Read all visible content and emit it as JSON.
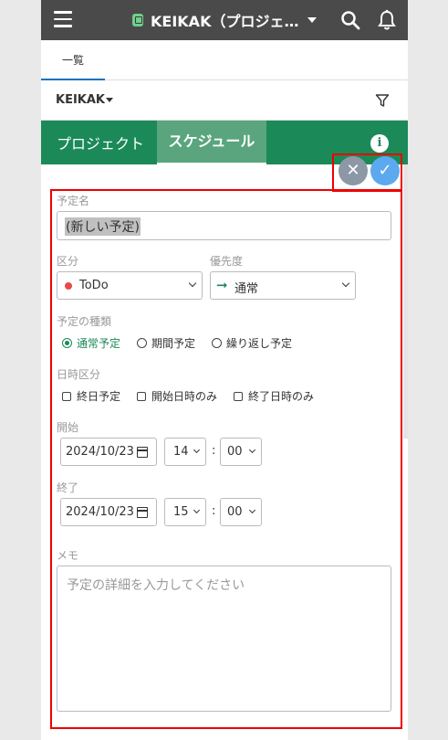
{
  "topbar": {
    "title": "KEIKAK（プロジェ…",
    "menu_icon": "hamburger-icon",
    "search_icon": "search-icon",
    "notification_icon": "bell-icon"
  },
  "list_tab": {
    "label": "一覧"
  },
  "filter": {
    "project": "KEIKAK",
    "filter_icon": "filter-icon"
  },
  "green_tabs": {
    "project": "プロジェクト",
    "schedule": "スケジュール",
    "info_icon": "info-icon"
  },
  "actions": {
    "cancel_glyph": "✕",
    "confirm_glyph": "✓"
  },
  "form": {
    "name_label": "予定名",
    "name_value": "(新しい予定)",
    "category_label": "区分",
    "category_value": "ToDo",
    "priority_label": "優先度",
    "priority_arrow": "➞",
    "priority_value": "通常",
    "type_label": "予定の種類",
    "type_options": [
      "通常予定",
      "期間予定",
      "繰り返し予定"
    ],
    "datetime_label": "日時区分",
    "datetime_options": [
      "終日予定",
      "開始日時のみ",
      "終了日時のみ"
    ],
    "start_label": "開始",
    "start_date": "2024/10/23",
    "start_hour": "14",
    "start_minute": "00",
    "end_label": "終了",
    "end_date": "2024/10/23",
    "end_hour": "15",
    "end_minute": "00",
    "time_separator": ":",
    "memo_label": "メモ",
    "memo_placeholder": "予定の詳細を入力してください"
  },
  "colors": {
    "brand_green": "#1b8a58",
    "highlight_red": "#e00000",
    "confirm_blue": "#5da9f0"
  }
}
